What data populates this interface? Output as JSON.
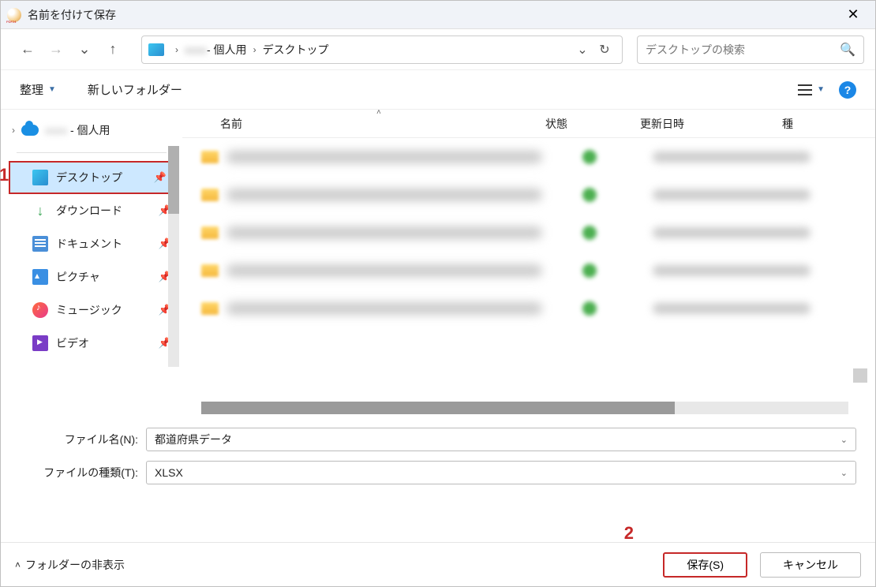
{
  "window": {
    "title": "名前を付けて保存"
  },
  "breadcrumb": {
    "personal": "- 個人用",
    "desktop": "デスクトップ"
  },
  "search": {
    "placeholder": "デスクトップの検索"
  },
  "toolbar": {
    "organize": "整理",
    "newfolder": "新しいフォルダー"
  },
  "tree": {
    "root_suffix": "- 個人用"
  },
  "quick": {
    "desktop": "デスクトップ",
    "downloads": "ダウンロード",
    "documents": "ドキュメント",
    "pictures": "ピクチャ",
    "music": "ミュージック",
    "videos": "ビデオ"
  },
  "columns": {
    "name": "名前",
    "status": "状態",
    "modified": "更新日時",
    "type": "種"
  },
  "filename": {
    "label": "ファイル名(N):",
    "value": "都道府県データ"
  },
  "filetype": {
    "label": "ファイルの種類(T):",
    "value": "XLSX"
  },
  "footer": {
    "hide_folders": "フォルダーの非表示",
    "save": "保存(S)",
    "cancel": "キャンセル"
  },
  "annotations": {
    "one": "1",
    "two": "2"
  }
}
